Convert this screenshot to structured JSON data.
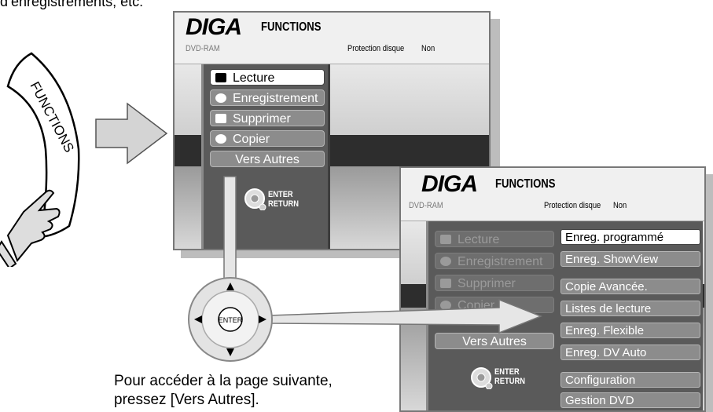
{
  "top_text": "d’enregistrements, etc.",
  "functions_button_label": "FUNCTIONS",
  "caption": {
    "line1": "Pour accéder à la page suivante,",
    "line2": "pressez [Vers Autres]."
  },
  "screen1": {
    "logo": "DIGA",
    "title": "FUNCTIONS",
    "disc": "DVD-RAM",
    "protection_label": "Protection disque",
    "protection_value": "Non",
    "menu": [
      {
        "label": "Lecture",
        "icon": "play-icon",
        "selected": true
      },
      {
        "label": "Enregistrement",
        "icon": "record-clock-icon",
        "selected": false
      },
      {
        "label": "Supprimer",
        "icon": "delete-icon",
        "selected": false
      },
      {
        "label": "Copier",
        "icon": "copy-icon",
        "selected": false
      },
      {
        "label": "Vers Autres",
        "icon": "",
        "selected": false
      }
    ],
    "enter_label": "ENTER",
    "return_label": "RETURN"
  },
  "screen2": {
    "logo": "DIGA",
    "title": "FUNCTIONS",
    "disc": "DVD-RAM",
    "protection_label": "Protection disque",
    "protection_value": "Non",
    "menu": [
      {
        "label": "Lecture",
        "icon": "play-icon"
      },
      {
        "label": "Enregistrement",
        "icon": "record-clock-icon"
      },
      {
        "label": "Supprimer",
        "icon": "delete-icon"
      },
      {
        "label": "Copier",
        "icon": "copy-icon"
      },
      {
        "label": "Vers Autres",
        "icon": ""
      }
    ],
    "submenu": [
      "Enreg. programmé",
      "Enreg. ShowView",
      "Copie Avancée.",
      "Listes de lecture",
      "Enreg. Flexible",
      "Enreg. DV Auto",
      "Configuration",
      "Gestion DVD"
    ],
    "enter_label": "ENTER",
    "return_label": "RETURN"
  },
  "remote_pad": {
    "center_label": "ENTER"
  },
  "colors": {
    "menu_panel": "#5a5a5a",
    "menu_item": "#8c8c8c",
    "selected_item": "#ffffff",
    "arrow_fill": "#d4d4d4"
  }
}
